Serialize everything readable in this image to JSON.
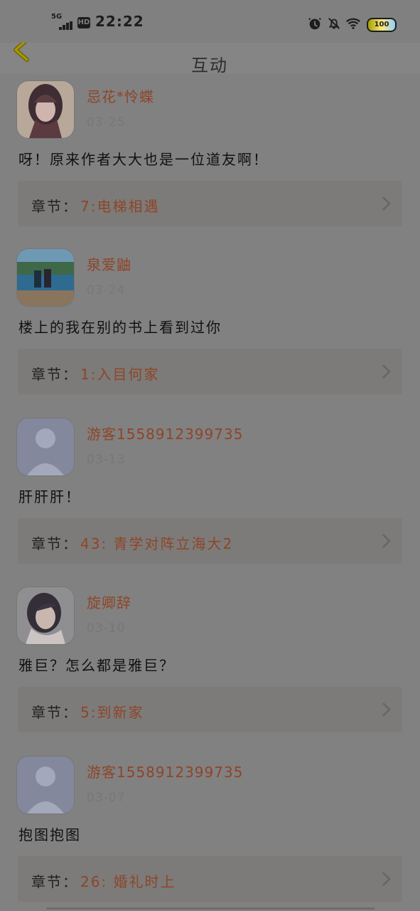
{
  "status_bar": {
    "network": "5G",
    "hd_badge": "HD",
    "time": "22:22",
    "battery_level": "100"
  },
  "header": {
    "title": "互动",
    "back_icon": "back-chevron-icon"
  },
  "comments": [
    {
      "username": "忌花*怜蝶",
      "date": "03-25",
      "text": "呀！原来作者大大也是一位道友啊！",
      "chapter_prefix": "章节：",
      "chapter_title": "7:电梯相遇",
      "avatar_icon": "profile-avatar-icon"
    },
    {
      "username": "泉爱鼬",
      "date": "03-24",
      "text": "楼上的我在别的书上看到过你",
      "chapter_prefix": "章节：",
      "chapter_title": "1:入目何家",
      "avatar_icon": "profile-avatar-icon"
    },
    {
      "username": "游客1558912399735",
      "date": "03-13",
      "text": "肝肝肝！",
      "chapter_prefix": "章节：",
      "chapter_title": "43: 青学对阵立海大2",
      "avatar_icon": "default-avatar-icon"
    },
    {
      "username": "旋卿辞",
      "date": "03-10",
      "text": "雅巨？怎么都是雅巨？",
      "chapter_prefix": "章节：",
      "chapter_title": "5:到新家",
      "avatar_icon": "profile-avatar-icon"
    },
    {
      "username": "游客1558912399735",
      "date": "03-07",
      "text": "抱图抱图",
      "chapter_prefix": "章节：",
      "chapter_title": "26: 婚礼时上",
      "avatar_icon": "default-avatar-icon"
    }
  ]
}
